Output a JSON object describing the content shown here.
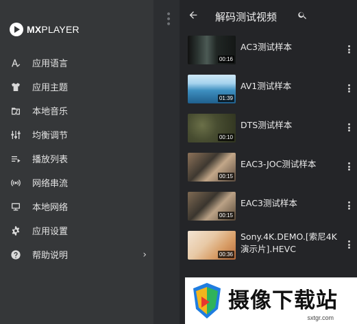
{
  "brand": {
    "logo_bold": "MX",
    "logo_rest": "PLAYER"
  },
  "nav": {
    "items": [
      {
        "label": "应用语言",
        "icon": "translate-icon"
      },
      {
        "label": "应用主题",
        "icon": "tshirt-icon"
      },
      {
        "label": "本地音乐",
        "icon": "music-folder-icon"
      },
      {
        "label": "均衡调节",
        "icon": "equalizer-icon"
      },
      {
        "label": "播放列表",
        "icon": "playlist-icon"
      },
      {
        "label": "网络串流",
        "icon": "stream-icon"
      },
      {
        "label": "本地网络",
        "icon": "network-icon"
      },
      {
        "label": "应用设置",
        "icon": "gear-icon"
      },
      {
        "label": "帮助说明",
        "icon": "help-icon",
        "has_chevron": true
      }
    ],
    "chevron": "›"
  },
  "header": {
    "title": "解码测试视频"
  },
  "videos": [
    {
      "title": "AC3测试样本",
      "duration": "00:16"
    },
    {
      "title": "AV1测试样本",
      "duration": "01:39"
    },
    {
      "title": "DTS测试样本",
      "duration": "00:10"
    },
    {
      "title": "EAC3-JOC测试样本",
      "duration": "00:15"
    },
    {
      "title": "EAC3测试样本",
      "duration": "00:15"
    },
    {
      "title": "Sony.4K.DEMO.[索尼4K演示片].HEVC",
      "duration": "00:36"
    }
  ],
  "watermark": {
    "text": "摄像下载站",
    "url": "sxtgr.com"
  },
  "colors": {
    "drawer_bg": "#353739",
    "panel_bg": "#242528",
    "text": "#e8e8e8"
  }
}
